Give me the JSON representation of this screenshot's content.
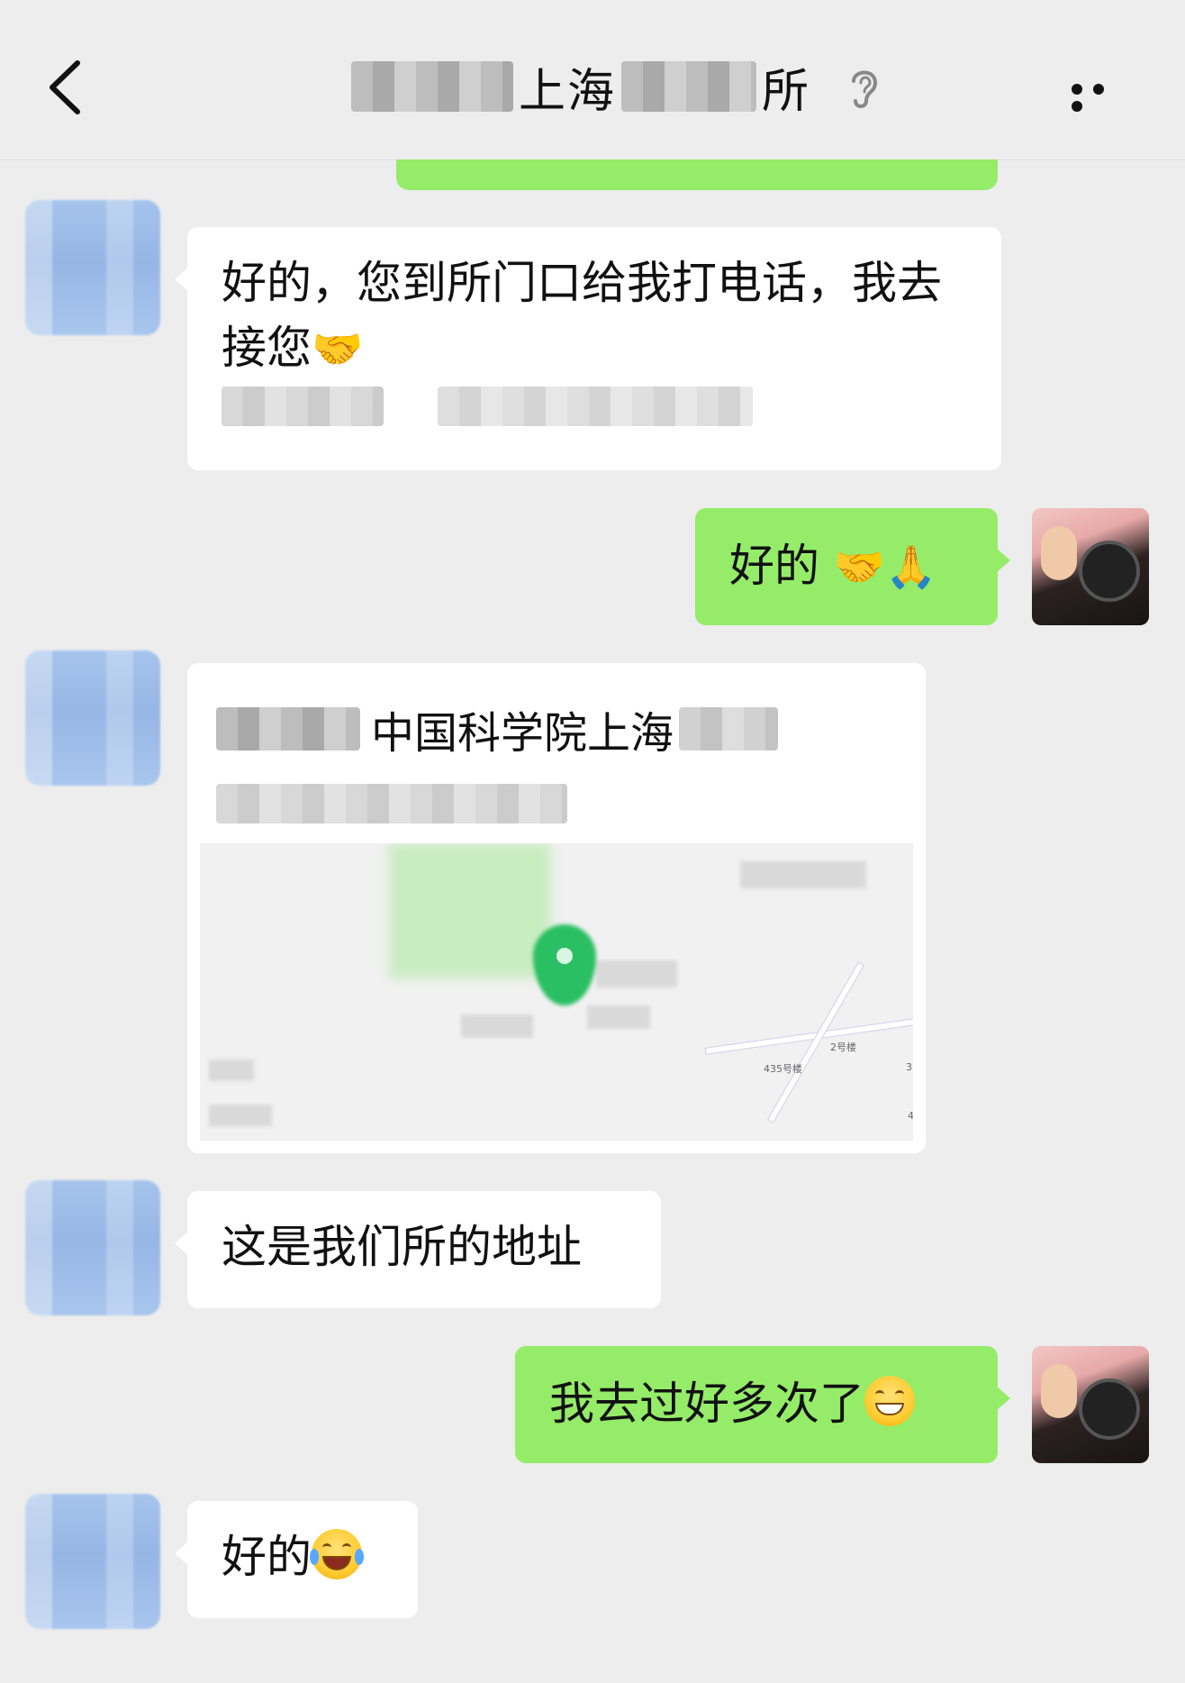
{
  "header": {
    "title_visible": "上海",
    "title_tail": "所",
    "back_icon": "chevron-left-icon",
    "mode_icon": "ear-icon",
    "more_icon": "more-dots-icon"
  },
  "messages": [
    {
      "side": "in",
      "text": "好的，您到所门口给我打电话，我去接您",
      "emoji": "handshake"
    },
    {
      "side": "out",
      "text": "好的 ",
      "emoji": "🤝🙏"
    },
    {
      "side": "in",
      "type": "location",
      "title": "中国科学院上海",
      "map_labels": [
        "2号楼",
        "435号楼",
        "3",
        "4"
      ]
    },
    {
      "side": "in",
      "text": "这是我们所的地址"
    },
    {
      "side": "out",
      "text": "我去过好多次了",
      "emoji": "grin"
    },
    {
      "side": "in",
      "text": "好的",
      "emoji": "tears-of-joy"
    }
  ],
  "colors": {
    "background": "#ededed",
    "bubble_out": "#95ec69",
    "bubble_in": "#ffffff",
    "map_pin": "#2bbf63"
  }
}
